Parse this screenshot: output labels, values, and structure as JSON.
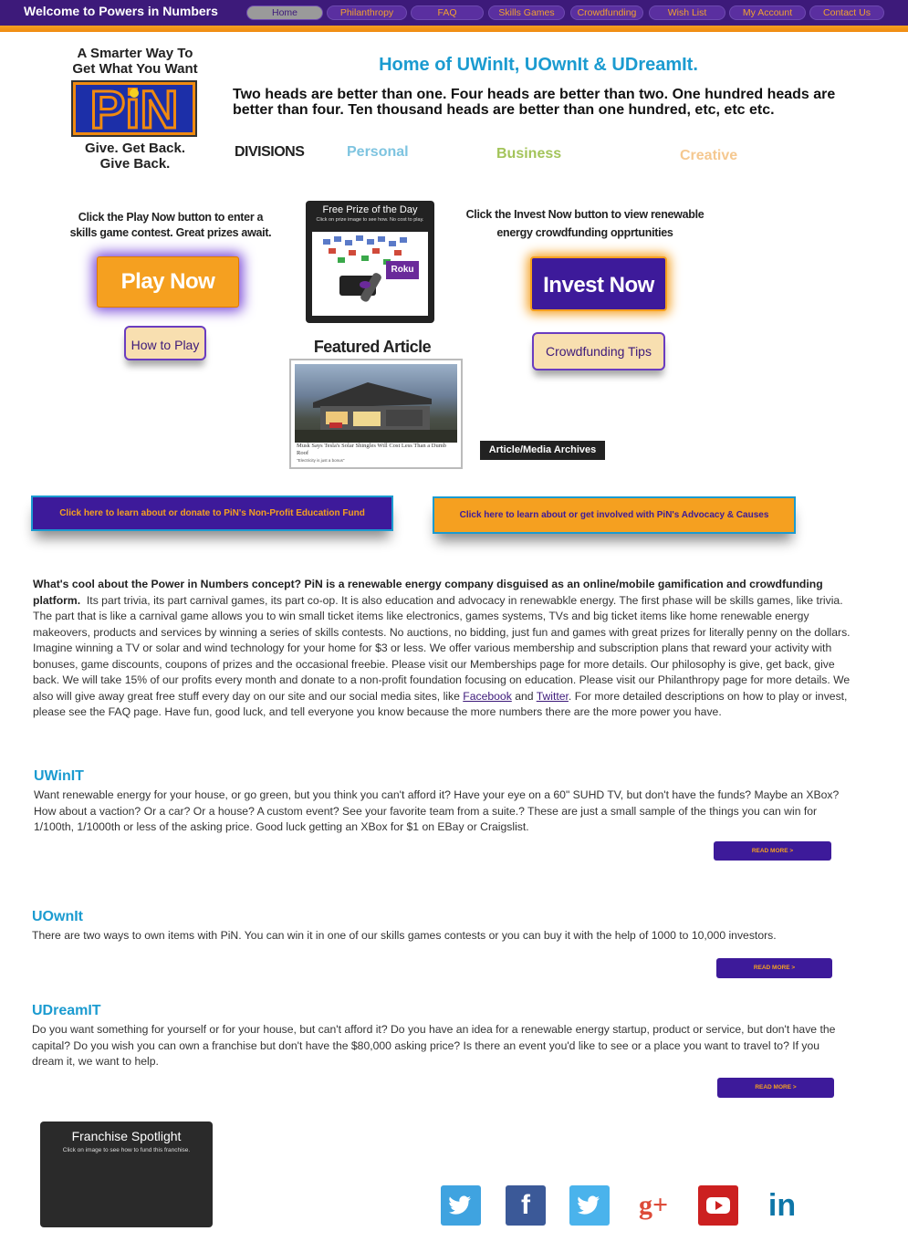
{
  "header": {
    "welcome": "Welcome to Powers in Numbers",
    "nav": [
      "Home",
      "Philanthropy",
      "FAQ",
      "Skills Games",
      "Crowdfunding",
      "Wish List",
      "My Account",
      "Contact Us"
    ]
  },
  "logo": {
    "top_text": "A Smarter Way To\nGet What You Want",
    "mark": "PiN",
    "bottom_text": "Give. Get Back.\nGive Back."
  },
  "hero": {
    "title": "Home of UWinIt, UOwnIt & UDreamIt.",
    "subtitle": "Two heads are better than one. Four heads are better than two. One hundred heads are better than four. Ten thousand heads are better than one hundred, etc, etc etc."
  },
  "divisions": {
    "label": "DIVISIONS",
    "personal": "Personal",
    "business": "Business",
    "creative": "Creative"
  },
  "play": {
    "text": "Click the Play Now button to enter a skills game contest. Great prizes await.",
    "button": "Play Now",
    "how_to": "How to Play"
  },
  "prize": {
    "title": "Free Prize of the Day",
    "subtitle": "Click on prize image to see how. No cost to play.",
    "badge": "Roku"
  },
  "featured": {
    "title": "Featured Article",
    "caption": "Musk Says Tesla's Solar Shingles Will Cost Less Than a Dumb Roof",
    "caption2": "\"Electricity is just a bonus\"",
    "archives": "Article/Media Archives"
  },
  "invest": {
    "text": "Click the Invest Now button to view renewable energy crowdfunding opprtunities",
    "button": "Invest Now",
    "tips": "Crowdfunding Tips"
  },
  "cta": {
    "education": "Click here to learn about or donate to PiN's Non-Profit Education Fund",
    "advocacy": "Click here to learn about or get involved with PiN's Advocacy & Causes"
  },
  "intro": {
    "bold": "What's cool about the Power in Numbers concept? PiN is a renewable energy company disguised as  an online/mobile gamification and crowdfunding platform.",
    "text": "Its part trivia, its part carnival games, its part co-op. It is also education and advocacy in renewabkle energy. The first phase will be skills games, like trivia. The part that is like a carnival game allows you to win small ticket items like electronics, games systems, TVs and big ticket items like home renewable energy makeovers, products and services by winning a series of skills contests. No auctions, no bidding, just fun and games with great prizes for literally penny on the dollars. Imagine winning a TV or solar and wind technology for your home for $3 or less. We offer various membership and subscription plans that reward your activity with bonuses, game discounts, coupons of prizes and the occasional freebie. Please visit our Memberships page for more details. Our philosophy is give, get back, give back. We will take 15% of our profits every month and donate to a non-profit foundation focusing on education. Please visit our Philanthropy page for more details. We also will give away great free stuff every day on our site and our social media sites, like",
    "facebook": "Facebook",
    "and": "and",
    "twitter": "Twitter",
    "tail": ". For more detailed descriptions on how to play or invest, please see the FAQ page. Have fun, good luck, and tell everyone you know because the more numbers there are the more power you have."
  },
  "uwinit": {
    "heading": "UWinIT",
    "text": "Want renewable energy for your house, or go green, but you think you can't afford it? Have your eye on a 60\" SUHD TV, but don't have the funds? Maybe an XBox? How about a vaction? Or a car? Or a house? A custom event? See your favorite team from a suite.? These are just a small sample of the things you can win for 1/100th, 1/1000th or less of the asking price. Good luck getting an XBox for $1 on EBay or Craigslist.",
    "more": "READ MORE >"
  },
  "uownit": {
    "heading": "UOwnIt",
    "text": "There are two ways to own items with PiN. You can win it in one of our skills games contests or you can buy it with the help of 1000 to 10,000 investors.",
    "more": "READ MORE >"
  },
  "udreamit": {
    "heading": "UDreamIT",
    "text": "Do you want something for yourself or for your house, but can't afford it? Do you have an idea for a renewable energy startup, product or service, but don't have the capital? Do you wish you can own a franchise but don't have the $80,000 asking price? Is there an event you'd like to see or a place you want to travel to? If you dream it, we want to help.",
    "more": "READ MORE >"
  },
  "franchise": {
    "title": "Franchise Spotlight",
    "subtitle": "Click on  image to see how to fund this franchise."
  },
  "social": [
    "twitter-icon",
    "facebook-icon",
    "twitter-icon",
    "google-plus-icon",
    "youtube-icon",
    "linkedin-icon"
  ]
}
